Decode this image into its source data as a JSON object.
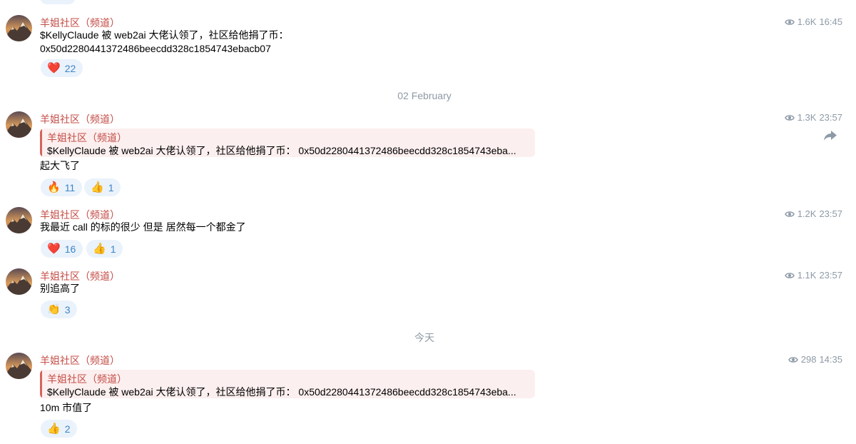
{
  "colors": {
    "sender": "#c44d46",
    "meta": "#8e9aa6",
    "reaction_bg": "#eaf2fb",
    "reaction_text": "#3d85c6",
    "reply_bg": "#fcefef",
    "reply_bar": "#d7625c"
  },
  "icons": {
    "views": "eye-icon",
    "forward": "share-arrow-icon",
    "avatar": "mountain-sunset-avatar"
  },
  "messages": [
    {
      "sender": "羊姐社区（频道）",
      "text_lines": [
        "$KellyClaude 被 web2ai 大佬认领了，社区给他捐了币：",
        "0x50d2280441372486beecdd328c1854743ebacb07"
      ],
      "views": "1.6K",
      "time": "16:45",
      "reactions": [
        {
          "emoji": "❤️",
          "count": "22"
        }
      ]
    },
    {
      "date_separator": "02 February"
    },
    {
      "sender": "羊姐社区（频道）",
      "reply": {
        "sender": "羊姐社区（频道）",
        "text": "$KellyClaude 被 web2ai 大佬认领了，社区给他捐了币：    0x50d2280441372486beecdd328c1854743eba..."
      },
      "text_lines": [
        "起大飞了"
      ],
      "views": "1.3K",
      "time": "23:57",
      "reactions": [
        {
          "emoji": "🔥",
          "count": "11"
        },
        {
          "emoji": "👍",
          "count": "1"
        }
      ]
    },
    {
      "sender": "羊姐社区（频道）",
      "text_lines": [
        "我最近 call 的标的很少 但是 居然每一个都金了"
      ],
      "views": "1.2K",
      "time": "23:57",
      "reactions": [
        {
          "emoji": "❤️",
          "count": "16"
        },
        {
          "emoji": "👍",
          "count": "1"
        }
      ]
    },
    {
      "sender": "羊姐社区（频道）",
      "text_lines": [
        "别追高了"
      ],
      "views": "1.1K",
      "time": "23:57",
      "reactions": [
        {
          "emoji": "👏",
          "count": "3"
        }
      ]
    },
    {
      "date_separator": "今天"
    },
    {
      "sender": "羊姐社区（频道）",
      "reply": {
        "sender": "羊姐社区（频道）",
        "text": "$KellyClaude 被 web2ai 大佬认领了，社区给他捐了币：    0x50d2280441372486beecdd328c1854743eba..."
      },
      "text_lines": [
        "10m 市值了"
      ],
      "views": "298",
      "time": "14:35",
      "reactions": [
        {
          "emoji": "👍",
          "count": "2"
        }
      ]
    }
  ]
}
